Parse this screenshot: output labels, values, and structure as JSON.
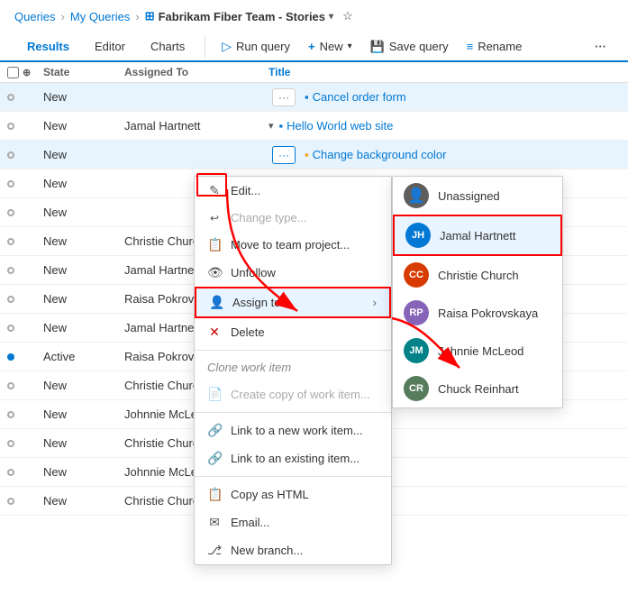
{
  "breadcrumb": {
    "queries": "Queries",
    "myQueries": "My Queries",
    "current": "Fabrikam Fiber Team - Stories"
  },
  "toolbar": {
    "tabs": [
      {
        "label": "Results",
        "active": true
      },
      {
        "label": "Editor",
        "active": false
      },
      {
        "label": "Charts",
        "active": false
      }
    ],
    "runQuery": "Run query",
    "new": "New",
    "saveQuery": "Save query",
    "rename": "Rename"
  },
  "table": {
    "headers": [
      "State",
      "Assigned To",
      "Title"
    ],
    "rows": [
      {
        "state": "New",
        "dot": "new",
        "assigned": "",
        "title": "Cancel order form",
        "iconType": "story",
        "hasMenu": true
      },
      {
        "state": "New",
        "dot": "new",
        "assigned": "Jamal Hartnett",
        "title": "Hello World web site",
        "iconType": "story",
        "hasMenu": false
      },
      {
        "state": "New",
        "dot": "new",
        "assigned": "",
        "title": "Change background color",
        "iconType": "task",
        "hasMenu": true,
        "menuOpen": true
      },
      {
        "state": "New",
        "dot": "new",
        "assigned": "",
        "title": "",
        "iconType": "story",
        "hasMenu": false
      },
      {
        "state": "New",
        "dot": "new",
        "assigned": "",
        "title": "",
        "iconType": "story",
        "hasMenu": false
      },
      {
        "state": "New",
        "dot": "new",
        "assigned": "Christie Church",
        "title": "",
        "iconType": "story",
        "hasMenu": false
      },
      {
        "state": "New",
        "dot": "new",
        "assigned": "Jamal Hartnett",
        "title": "",
        "iconType": "story",
        "hasMenu": false
      },
      {
        "state": "New",
        "dot": "new",
        "assigned": "Raisa Pokrovska",
        "title": "",
        "iconType": "story",
        "hasMenu": false
      },
      {
        "state": "New",
        "dot": "new",
        "assigned": "Jamal Hartnett",
        "title": "",
        "iconType": "story",
        "hasMenu": false
      },
      {
        "state": "Active",
        "dot": "active",
        "assigned": "Raisa Pokrovska",
        "title": "",
        "iconType": "story",
        "hasMenu": false
      },
      {
        "state": "New",
        "dot": "new",
        "assigned": "Christie Church",
        "title": "",
        "iconType": "story",
        "hasMenu": false
      },
      {
        "state": "New",
        "dot": "new",
        "assigned": "Johnnie McLeod",
        "title": "",
        "iconType": "story",
        "hasMenu": false
      },
      {
        "state": "New",
        "dot": "new",
        "assigned": "Christie Church",
        "title": "",
        "iconType": "story",
        "hasMenu": false
      },
      {
        "state": "New",
        "dot": "new",
        "assigned": "Johnnie McLeod",
        "title": "",
        "iconType": "story",
        "hasMenu": false
      },
      {
        "state": "New",
        "dot": "new",
        "assigned": "Christie Church",
        "title": "",
        "iconType": "story",
        "hasMenu": false
      }
    ]
  },
  "contextMenu": {
    "items": [
      {
        "label": "Edit...",
        "icon": "✏️",
        "disabled": false
      },
      {
        "label": "Change type...",
        "icon": "↩",
        "disabled": true
      },
      {
        "label": "Move to team project...",
        "icon": "📋",
        "disabled": false
      },
      {
        "label": "Unfollow",
        "icon": "👁",
        "disabled": false
      },
      {
        "label": "Assign to",
        "icon": "👤",
        "disabled": false,
        "hasSubmenu": true
      },
      {
        "label": "Delete",
        "icon": "✕",
        "disabled": false
      },
      {
        "label": "Clone work item",
        "icon": "",
        "disabled": true,
        "sectionLabel": true
      },
      {
        "label": "Create copy of work item...",
        "icon": "📄",
        "disabled": true
      },
      {
        "label": "Link to a new work item...",
        "icon": "🔗",
        "disabled": false
      },
      {
        "label": "Link to an existing item...",
        "icon": "🔗",
        "disabled": false
      },
      {
        "label": "Copy as HTML",
        "icon": "📋",
        "disabled": false
      },
      {
        "label": "Email...",
        "icon": "✉️",
        "disabled": false
      },
      {
        "label": "New branch...",
        "icon": "🌿",
        "disabled": false
      }
    ]
  },
  "assignSubmenu": {
    "items": [
      {
        "label": "Unassigned",
        "avatarType": "unassigned",
        "initials": "👤"
      },
      {
        "label": "Jamal Hartnett",
        "avatarType": "jamal",
        "initials": "JH",
        "selected": true
      },
      {
        "label": "Christie Church",
        "avatarType": "christie",
        "initials": "CC"
      },
      {
        "label": "Raisa Pokrovskaya",
        "avatarType": "raisa",
        "initials": "RP"
      },
      {
        "label": "Johnnie McLeod",
        "avatarType": "johnnie",
        "initials": "JM"
      },
      {
        "label": "Chuck Reinhart",
        "avatarType": "chuck",
        "initials": "CR"
      }
    ]
  }
}
